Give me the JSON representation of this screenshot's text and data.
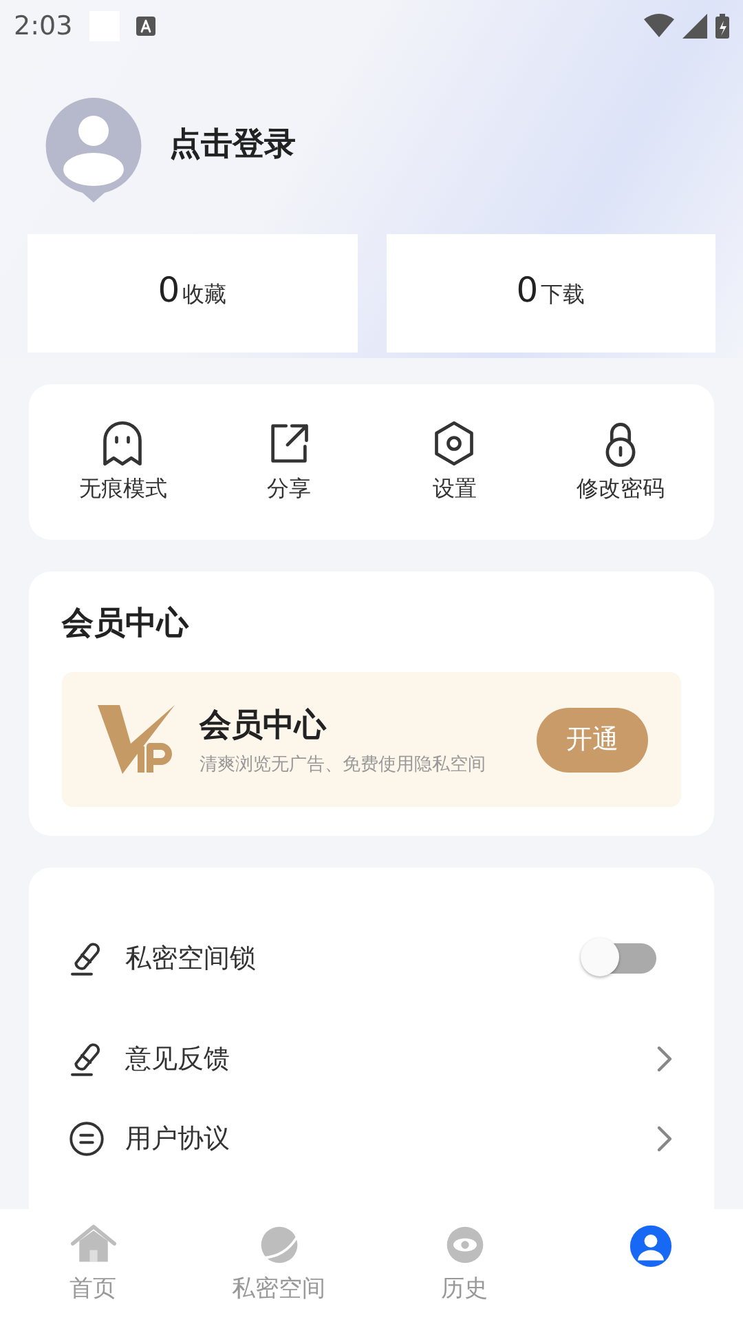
{
  "status_bar": {
    "time": "2:03"
  },
  "profile": {
    "login_label": "点击登录"
  },
  "stats": [
    {
      "count": "0",
      "label": "收藏"
    },
    {
      "count": "0",
      "label": "下载"
    }
  ],
  "actions": [
    {
      "kind": "ghost",
      "label": "无痕模式"
    },
    {
      "kind": "share",
      "label": "分享"
    },
    {
      "kind": "settings",
      "label": "设置"
    },
    {
      "kind": "lock",
      "label": "修改密码"
    }
  ],
  "membership": {
    "title": "会员中心",
    "banner_title": "会员中心",
    "banner_subtitle": "清爽浏览无广告、免费使用隐私空间",
    "button": "开通"
  },
  "settings_list": [
    {
      "kind": "toggle",
      "label": "私密空间锁",
      "on": false
    },
    {
      "kind": "link",
      "label": "意见反馈"
    },
    {
      "kind": "link",
      "label": "用户协议"
    }
  ],
  "tab_bar": [
    {
      "label": "首页",
      "selected": false
    },
    {
      "label": "私密空间",
      "selected": false
    },
    {
      "label": "历史",
      "selected": false
    },
    {
      "selected": true
    }
  ]
}
